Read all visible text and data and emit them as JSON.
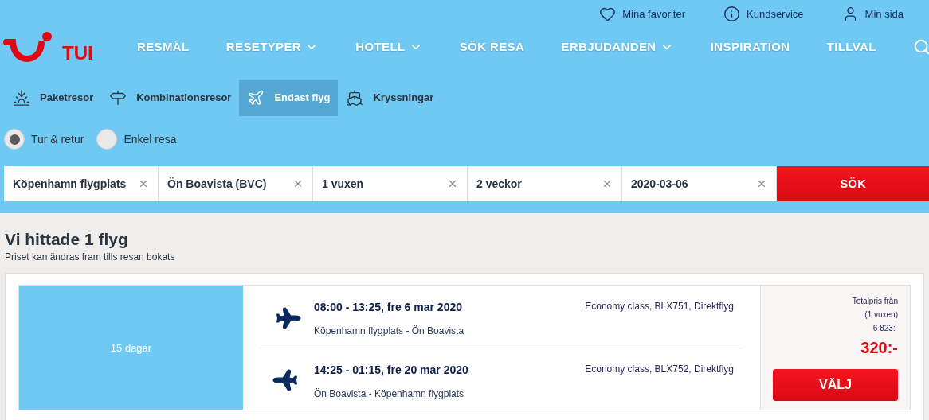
{
  "top_links": [
    {
      "kind": "heart",
      "label": "Mina favoriter"
    },
    {
      "kind": "info",
      "label": "Kundservice"
    },
    {
      "kind": "user",
      "label": "Min sida"
    }
  ],
  "logo": {
    "text": "TUI"
  },
  "nav": [
    {
      "label": "RESMÅL",
      "has_menu": false
    },
    {
      "label": "RESETYPER",
      "has_menu": true
    },
    {
      "label": "HOTELL",
      "has_menu": true
    },
    {
      "label": "SÖK RESA",
      "has_menu": false
    },
    {
      "label": "ERBJUDANDEN",
      "has_menu": true
    },
    {
      "label": "INSPIRATION",
      "has_menu": false
    },
    {
      "label": "TILLVAL",
      "has_menu": false
    }
  ],
  "trip_types": [
    {
      "kind": "sun",
      "label": "Paketresor",
      "selected": false
    },
    {
      "kind": "signpost",
      "label": "Kombinationsresor",
      "selected": false
    },
    {
      "kind": "plane",
      "label": "Endast flyg",
      "selected": true
    },
    {
      "kind": "ship",
      "label": "Kryssningar",
      "selected": false
    }
  ],
  "radios": [
    {
      "label": "Tur & retur",
      "selected": true
    },
    {
      "label": "Enkel resa",
      "selected": false
    }
  ],
  "search_fields": [
    {
      "value": "Köpenhamn flygplats"
    },
    {
      "value": "Ön Boavista (BVC)"
    },
    {
      "value": "1 vuxen"
    },
    {
      "value": "2 veckor"
    },
    {
      "value": "2020-03-06"
    }
  ],
  "search_button": "SÖK",
  "results": {
    "title": "Vi hittade 1 flyg",
    "subtitle": "Priset kan ändras fram tills resan bokats"
  },
  "flight": {
    "duration": "15 dagar",
    "legs": [
      {
        "kind": "outbound",
        "times": "08:00 - 13:25, fre 6 mar 2020",
        "route": "Köpenhamn flygplats - Ön Boavista",
        "details": "Economy class, BLX751, Direktflyg"
      },
      {
        "kind": "return",
        "times": "14:25 - 01:15, fre 20 mar 2020",
        "route": "Ön Boavista - Köpenhamn flygplats",
        "details": "Economy class, BLX752, Direktflyg"
      }
    ],
    "price_label": "Totalpris från",
    "price_note": "(1 vuxen)",
    "old_price": "6 823:-",
    "price": "320:-",
    "button": "VÄLJ"
  }
}
